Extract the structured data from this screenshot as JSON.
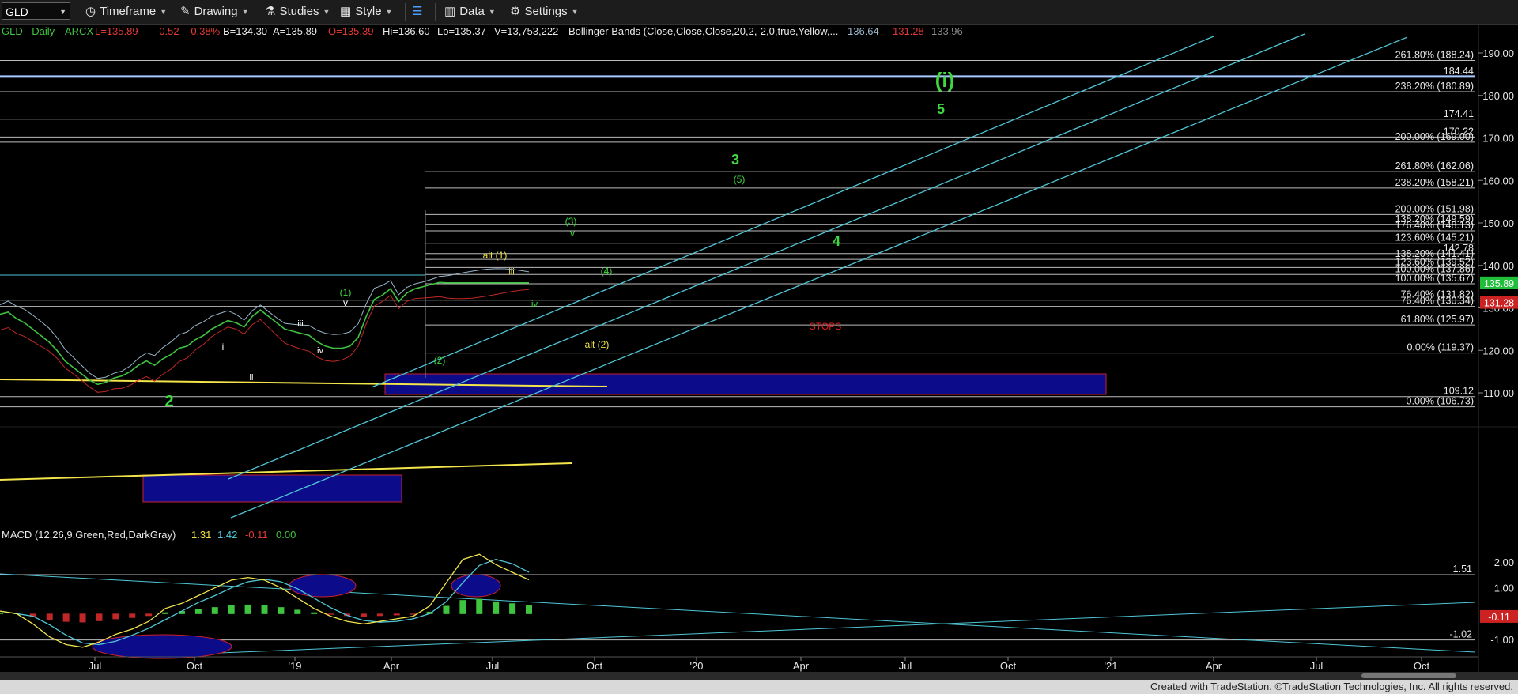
{
  "toolbar": {
    "symbol": "GLD",
    "timeframe": "Timeframe",
    "drawing": "Drawing",
    "studies": "Studies",
    "style": "Style",
    "data": "Data",
    "settings": "Settings"
  },
  "header": {
    "name": "GLD - Daily",
    "exchange": "ARCX",
    "last": "L=135.89",
    "change": "-0.52",
    "change_pct": "-0.38%",
    "bid": "B=134.30",
    "ask": "A=135.89",
    "open": "O=135.39",
    "high": "Hi=136.60",
    "low": "Lo=135.37",
    "volume": "V=13,753,222",
    "bb_label": "Bollinger Bands (Close,Close,Close,20,2,-2,0,true,Yellow,...",
    "bb_upper": "136.64",
    "bb_lower": "131.28",
    "bb_mid": "133.96"
  },
  "macd_header": {
    "label": "MACD (12,26,9,Green,Red,DarkGray)",
    "macd": "1.31",
    "signal": "1.42",
    "diff": "-0.11",
    "zero": "0.00"
  },
  "footer": {
    "credit": "Created with TradeStation. ©TradeStation Technologies, Inc. All rights reserved."
  },
  "colors": {
    "background": "#000000",
    "price": "#3ec43e",
    "bb": "#9ab6c9",
    "trend_yellow": "#f2e44a",
    "channel": "#4fc6d6",
    "box_fill": "#0c0c8a",
    "box_border": "#c8202a",
    "wave_green": "#3fd93f",
    "fib_line": "#c8c8c8",
    "last_tag": "#1fbf3a",
    "lower_tag": "#cc2222"
  },
  "chart_data": {
    "type": "line",
    "title": "GLD - Daily",
    "ylim": [
      101,
      198
    ],
    "x_ticks": [
      "Jul",
      "Oct",
      "'19",
      "Apr",
      "Jul",
      "Oct",
      "'20",
      "Apr",
      "Jul",
      "Oct",
      "'21",
      "Apr",
      "Jul",
      "Oct"
    ],
    "y_ticks": [
      "190.00",
      "180.00",
      "170.00",
      "160.00",
      "150.00",
      "140.00",
      "130.00",
      "120.00",
      "110.00"
    ],
    "price_series": {
      "name": "GLD",
      "x_index": [
        0,
        5,
        10,
        15,
        20,
        25,
        30,
        35,
        40,
        45,
        50,
        55,
        60,
        65,
        70,
        75,
        80,
        85,
        90,
        95,
        100,
        105,
        110,
        115,
        120,
        125,
        130,
        135,
        140,
        145,
        150,
        155,
        160,
        165,
        170,
        175,
        180,
        185,
        190,
        195,
        200,
        205,
        210,
        215,
        220,
        225,
        230,
        235,
        240,
        245,
        250,
        255,
        260,
        265,
        270,
        275,
        280,
        285,
        290,
        295,
        300,
        305,
        310,
        315,
        320,
        325
      ],
      "close": [
        128.5,
        129.0,
        127.5,
        126.5,
        125.0,
        123.5,
        122.0,
        120.0,
        117.5,
        116.0,
        114.5,
        113.0,
        112.0,
        112.5,
        113.5,
        114.0,
        115.0,
        116.5,
        117.5,
        116.5,
        118.0,
        119.0,
        120.5,
        121.0,
        122.5,
        123.5,
        125.0,
        126.0,
        127.0,
        126.5,
        125.5,
        128.0,
        129.5,
        128.0,
        126.5,
        125.0,
        124.5,
        124.0,
        123.5,
        122.0,
        121.0,
        120.5,
        120.5,
        121.0,
        123.0,
        128.0,
        132.0,
        133.0,
        134.5,
        131.5,
        133.5,
        134.5,
        135.0,
        135.5,
        136.0,
        135.89,
        135.89,
        135.89,
        135.89,
        135.89,
        135.89,
        135.89,
        135.89,
        135.89,
        135.89,
        135.89
      ]
    },
    "fib_levels": [
      {
        "label": "261.80% (188.24)",
        "value": 188.24
      },
      {
        "label": "184.44",
        "value": 184.44
      },
      {
        "label": "238.20% (180.89)",
        "value": 180.89
      },
      {
        "label": "174.41",
        "value": 174.41
      },
      {
        "label": "170.22",
        "value": 170.22
      },
      {
        "label": "200.00% (169.00)",
        "value": 169.0
      },
      {
        "label": "261.80% (162.06)",
        "value": 162.06
      },
      {
        "label": "238.20% (158.21)",
        "value": 158.21
      },
      {
        "label": "200.00% (151.98)",
        "value": 151.98
      },
      {
        "label": "138.20% (149.59)",
        "value": 149.59
      },
      {
        "label": "176.40% (148.13)",
        "value": 148.13
      },
      {
        "label": "123.60% (145.21)",
        "value": 145.21
      },
      {
        "label": "142.78",
        "value": 142.78
      },
      {
        "label": "138.20% (141.41)",
        "value": 141.41
      },
      {
        "label": "123.60% (139.52)",
        "value": 139.52
      },
      {
        "label": "100.00% (137.86)",
        "value": 137.86
      },
      {
        "label": "100.00% (135.67)",
        "value": 135.67
      },
      {
        "label": "76.40% (131.82)",
        "value": 131.82
      },
      {
        "label": "76.40% (130.34)",
        "value": 130.34
      },
      {
        "label": "61.80% (125.97)",
        "value": 125.97
      },
      {
        "label": "0.00% (119.37)",
        "value": 119.37
      },
      {
        "label": "109.12",
        "value": 109.12
      },
      {
        "label": "0.00% (106.73)",
        "value": 106.73
      }
    ],
    "wave_labels": [
      {
        "text": "(i)",
        "x": 1195,
        "y": 110,
        "color": "#3fd93f",
        "size": 26
      },
      {
        "text": "5",
        "x": 1190,
        "y": 144,
        "color": "#3fd93f",
        "size": 18
      },
      {
        "text": "3",
        "x": 930,
        "y": 208,
        "color": "#3fd93f",
        "size": 18
      },
      {
        "text": "(5)",
        "x": 935,
        "y": 231,
        "color": "#3fd93f",
        "size": 12
      },
      {
        "text": "(3)",
        "x": 722,
        "y": 284,
        "color": "#3fd93f",
        "size": 12
      },
      {
        "text": "v",
        "x": 724,
        "y": 299,
        "color": "#3fd93f",
        "size": 12
      },
      {
        "text": "4",
        "x": 1058,
        "y": 311,
        "color": "#3fd93f",
        "size": 18
      },
      {
        "text": "alt (1)",
        "x": 626,
        "y": 327,
        "color": "#f2e44a",
        "size": 12
      },
      {
        "text": "(4)",
        "x": 767,
        "y": 347,
        "color": "#3fd93f",
        "size": 12
      },
      {
        "text": "iii",
        "x": 647,
        "y": 347,
        "color": "#f2e44a",
        "size": 11
      },
      {
        "text": "iv",
        "x": 676,
        "y": 388,
        "color": "#3fd93f",
        "size": 11
      },
      {
        "text": "(1)",
        "x": 437,
        "y": 374,
        "color": "#3fd93f",
        "size": 12
      },
      {
        "text": "v",
        "x": 437,
        "y": 387,
        "color": "#ffffff",
        "size": 12
      },
      {
        "text": "iii",
        "x": 380,
        "y": 413,
        "color": "#ffffff",
        "size": 11
      },
      {
        "text": "iv",
        "x": 405,
        "y": 447,
        "color": "#ffffff",
        "size": 11
      },
      {
        "text": "i",
        "x": 282,
        "y": 443,
        "color": "#ffffff",
        "size": 12
      },
      {
        "text": "ii",
        "x": 318,
        "y": 481,
        "color": "#ffffff",
        "size": 11
      },
      {
        "text": "(2)",
        "x": 556,
        "y": 460,
        "color": "#3fd93f",
        "size": 12
      },
      {
        "text": "alt (2)",
        "x": 755,
        "y": 440,
        "color": "#f2e44a",
        "size": 12
      },
      {
        "text": "2",
        "x": 214,
        "y": 514,
        "color": "#3fd93f",
        "size": 20
      },
      {
        "text": "STOPS",
        "x": 1044,
        "y": 417,
        "color": "#e02020",
        "size": 12
      }
    ],
    "price_tags": [
      {
        "label": "135.89",
        "value": 135.89,
        "color": "#1fbf3a"
      },
      {
        "label": "131.28",
        "value": 131.28,
        "color": "#cc2222"
      }
    ],
    "macd": {
      "ylim": [
        -1.6,
        2.6
      ],
      "y_ticks": [
        "2.00",
        "1.00",
        "-1.00"
      ],
      "levels": [
        {
          "label": "1.51",
          "value": 1.51
        },
        {
          "label": "-1.02",
          "value": -1.02
        }
      ],
      "tag": {
        "label": "-0.11",
        "value": -0.11
      },
      "macd_line": [
        0.1,
        0.0,
        -0.4,
        -0.9,
        -1.2,
        -1.3,
        -1.1,
        -0.8,
        -0.6,
        -0.3,
        0.2,
        0.4,
        0.7,
        1.0,
        1.3,
        1.4,
        1.3,
        1.0,
        0.6,
        0.2,
        -0.1,
        -0.3,
        -0.4,
        -0.3,
        -0.2,
        -0.1,
        0.3,
        1.2,
        2.1,
        2.3,
        1.9,
        1.6,
        1.31
      ]
    }
  }
}
